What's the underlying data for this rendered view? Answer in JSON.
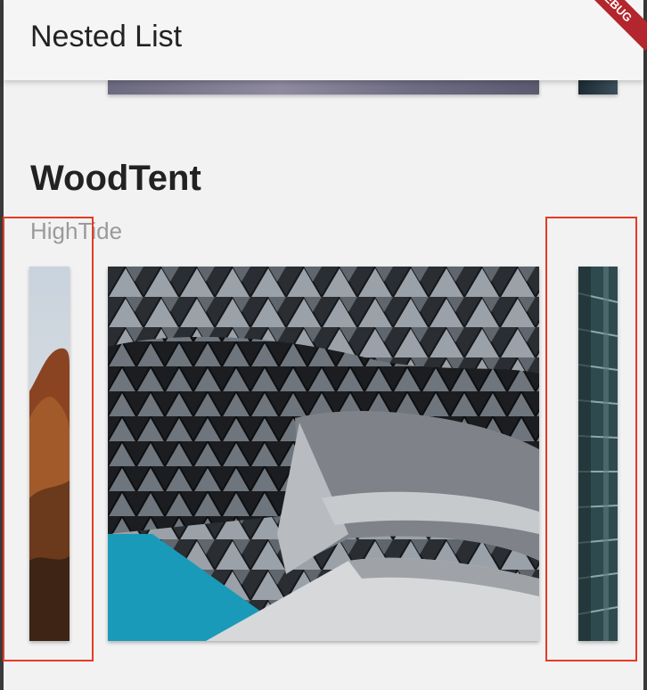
{
  "app_bar": {
    "title": "Nested List",
    "debug_label": "DEBUG"
  },
  "section": {
    "title": "WoodTent",
    "subtitle": "HighTide"
  },
  "images": [
    {
      "subject": "canyon rock landscape"
    },
    {
      "subject": "modern architecture with triangular glass facade"
    },
    {
      "subject": "glass building facade"
    }
  ],
  "highlights": [
    "left-card-highlight",
    "right-card-highlight"
  ],
  "colors": {
    "background": "#f2f2f2",
    "app_bar": "#f5f5f5",
    "highlight": "#e53a25",
    "subtitle": "#9a9a9a"
  }
}
